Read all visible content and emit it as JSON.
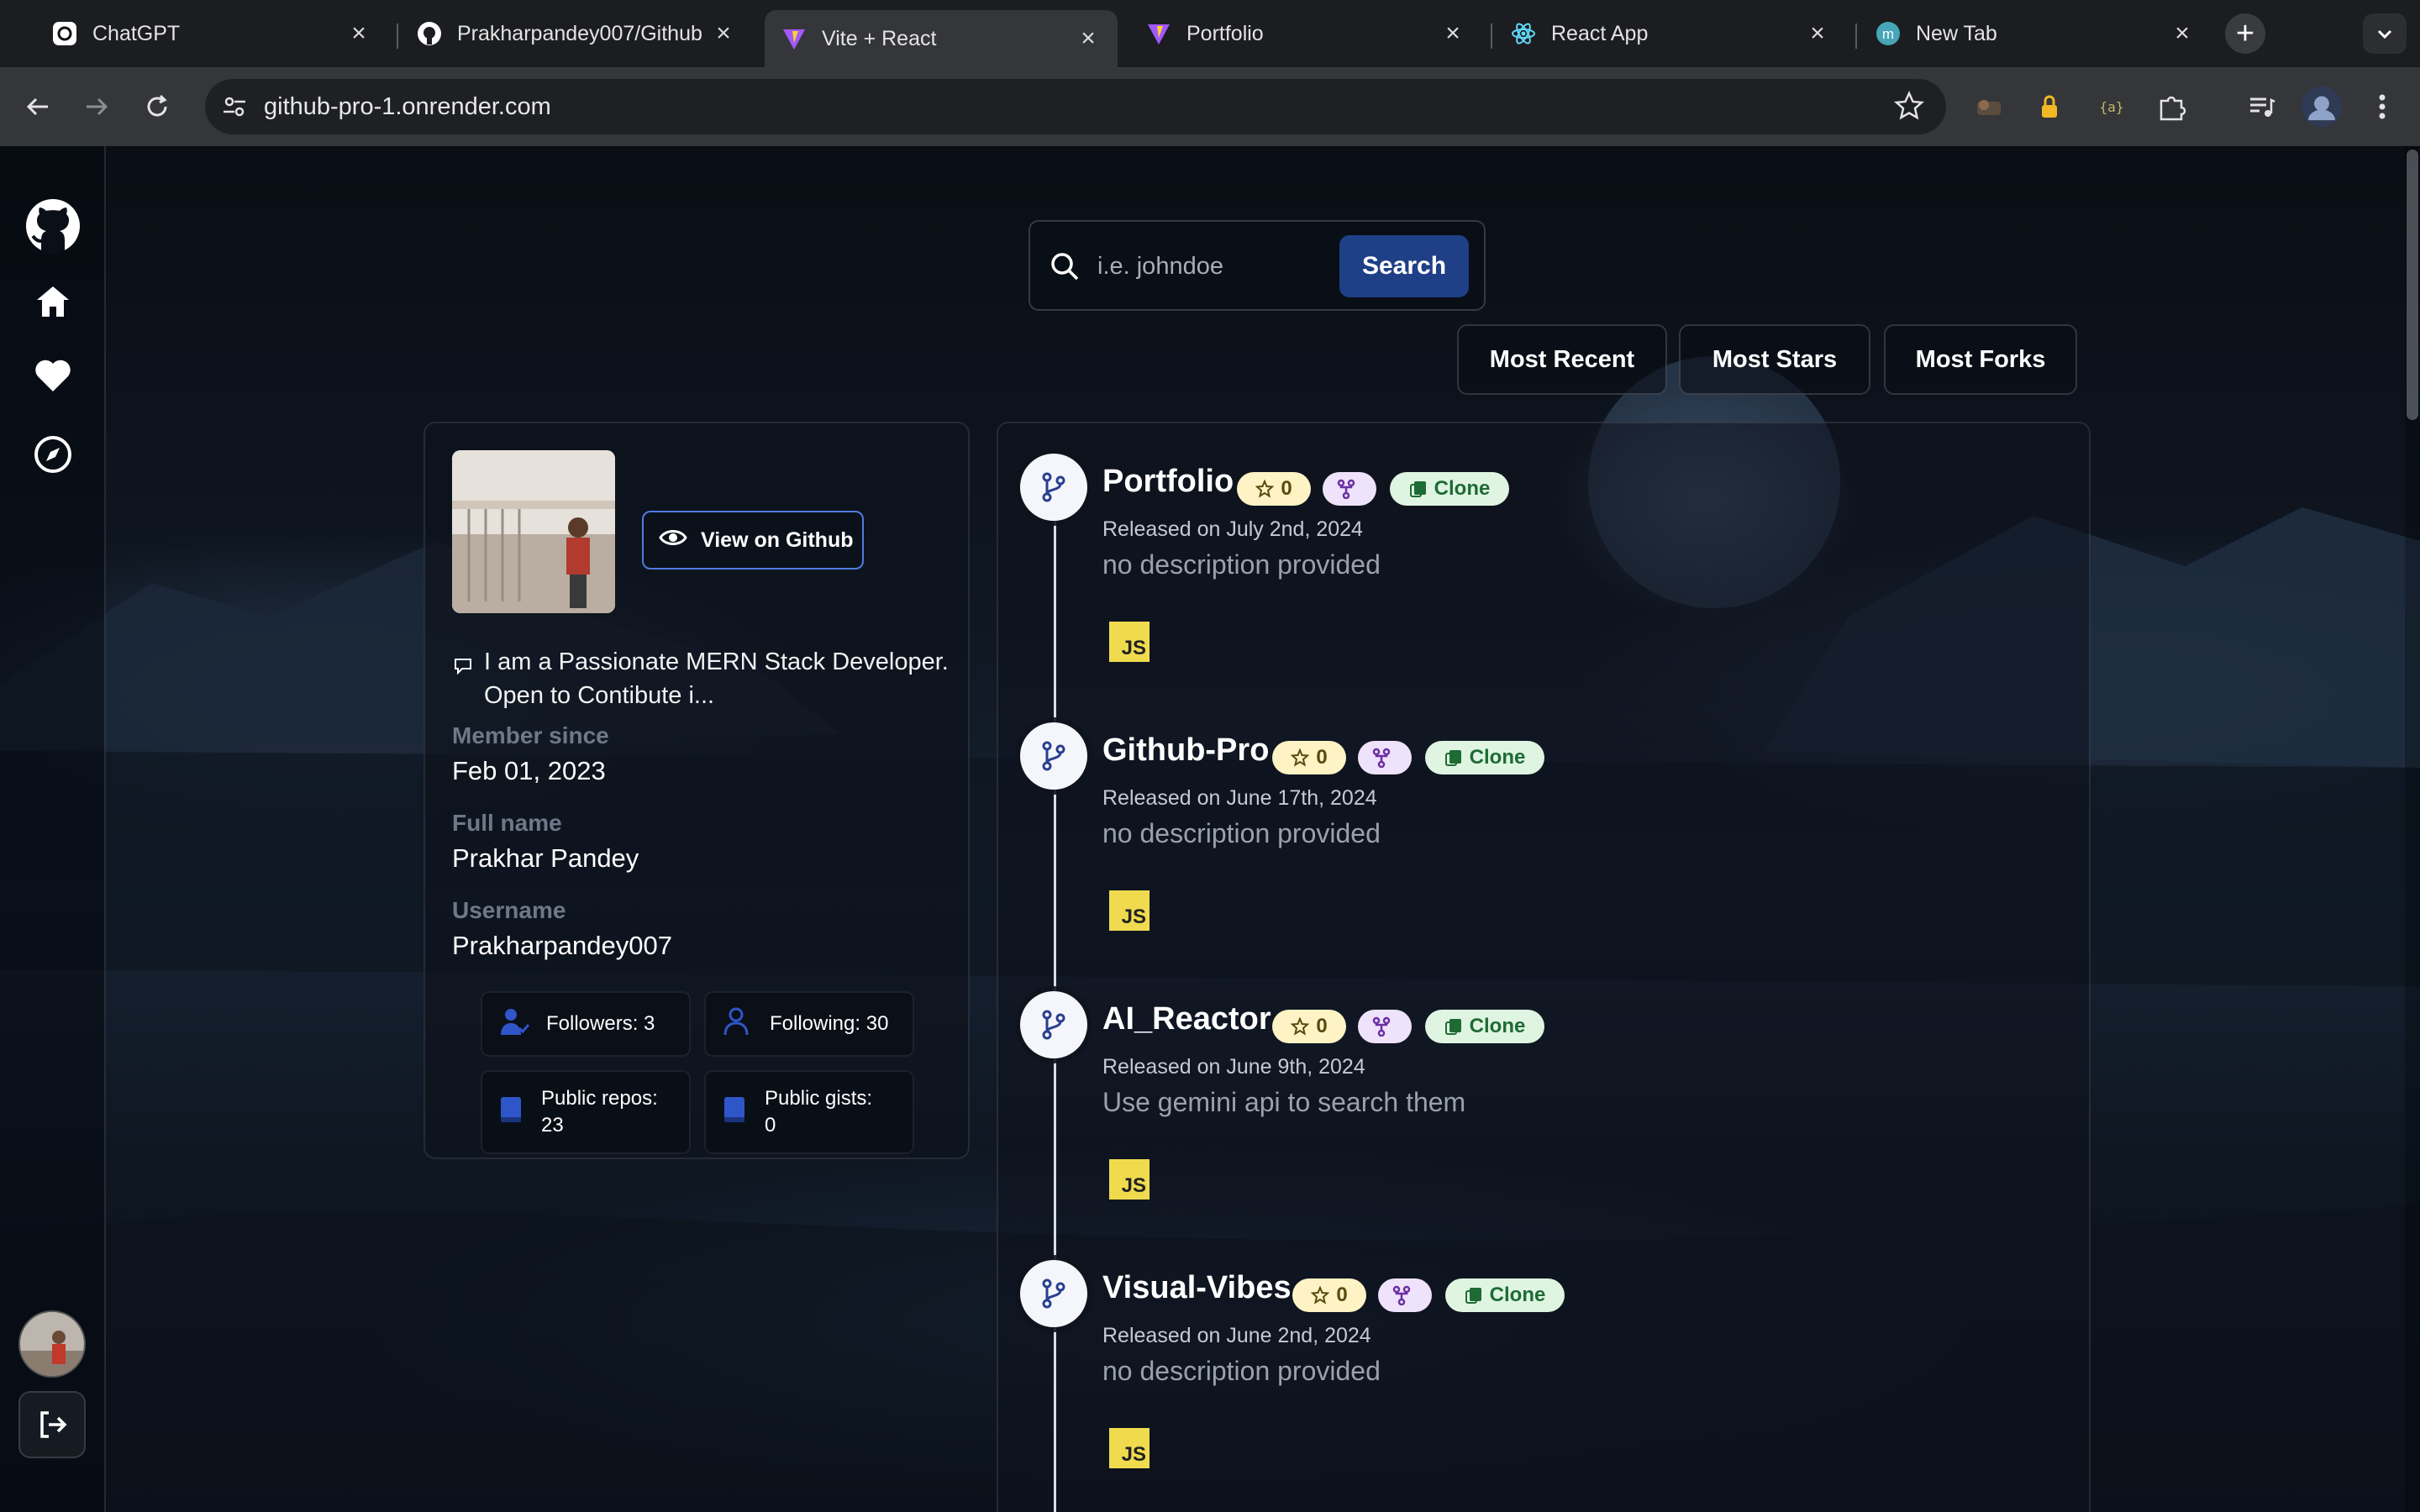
{
  "browser": {
    "tabs": [
      {
        "title": "ChatGPT",
        "icon": "chatgpt-icon"
      },
      {
        "title": "Prakharpandey007/Github",
        "icon": "github-icon"
      },
      {
        "title": "Vite + React",
        "icon": "vite-icon",
        "active": true
      },
      {
        "title": "Portfolio",
        "icon": "vite-icon"
      },
      {
        "title": "React App",
        "icon": "react-icon"
      },
      {
        "title": "New Tab",
        "icon": "m-icon"
      }
    ],
    "url": "github-pro-1.onrender.com"
  },
  "search": {
    "placeholder": "i.e. johndoe",
    "button_label": "Search"
  },
  "sort_buttons": {
    "recent": "Most Recent",
    "stars": "Most Stars",
    "forks": "Most Forks"
  },
  "profile": {
    "view_label": "View on Github",
    "bio": "I am a Passionate MERN Stack Developer. Open to Contibute i...",
    "member_since_label": "Member since",
    "member_since": "Feb 01, 2023",
    "full_name_label": "Full name",
    "full_name": "Prakhar Pandey",
    "username_label": "Username",
    "username": "Prakharpandey007",
    "stats": {
      "followers": "Followers: 3",
      "following": "Following: 30",
      "repos_label": "Public repos:",
      "repos_value": "23",
      "gists_label": "Public gists:",
      "gists_value": "0"
    }
  },
  "repos": [
    {
      "name": "Portfolio",
      "stars": "0",
      "clone_label": "Clone",
      "released": "Released on July 2nd, 2024",
      "description": "no description provided",
      "language": "JS"
    },
    {
      "name": "Github-Pro",
      "stars": "0",
      "clone_label": "Clone",
      "released": "Released on June 17th, 2024",
      "description": "no description provided",
      "language": "JS"
    },
    {
      "name": "AI_Reactor",
      "stars": "0",
      "clone_label": "Clone",
      "released": "Released on June 9th, 2024",
      "description": "Use gemini api to search them",
      "language": "JS"
    },
    {
      "name": "Visual-Vibes",
      "stars": "0",
      "clone_label": "Clone",
      "released": "Released on June 2nd, 2024",
      "description": "no description provided",
      "language": "JS"
    }
  ],
  "colors": {
    "accent": "#1f3f86",
    "star_pill": "#fdf3c4",
    "fork_pill": "#efe2fb",
    "clone_pill": "#dff5e2",
    "js_badge": "#f0db4f"
  }
}
